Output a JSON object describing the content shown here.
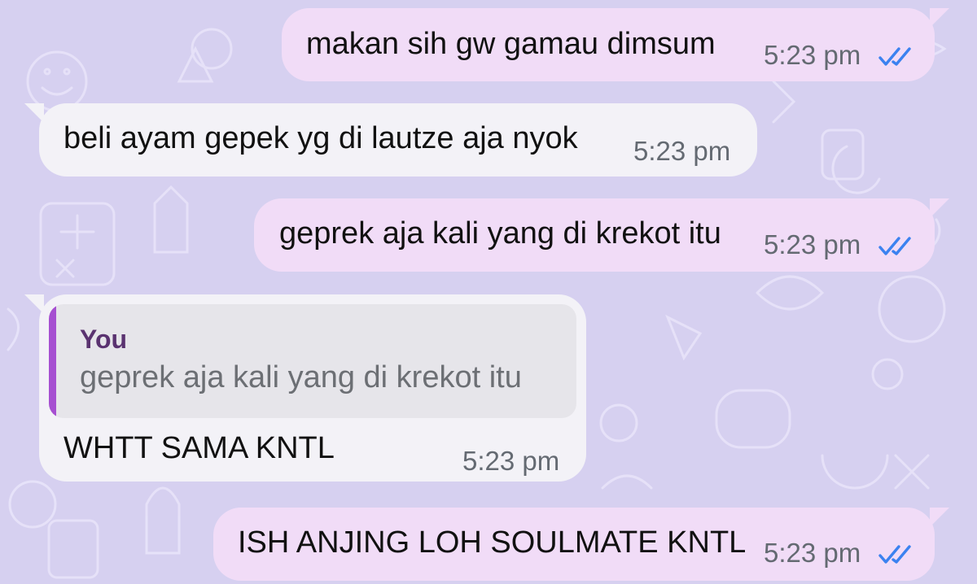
{
  "chat": {
    "colors": {
      "background": "#d6d0f0",
      "outgoing_bubble": "#f1dcf7",
      "incoming_bubble": "#f3f2f7",
      "read_ticks": "#3b82f0",
      "quote_accent": "#a64fd1"
    },
    "messages": [
      {
        "direction": "outgoing",
        "text": "makan sih gw gamau dimsum",
        "time": "5:23 pm",
        "status_icon": "double-check-read-icon"
      },
      {
        "direction": "incoming",
        "text": "beli ayam gepek yg di lautze aja nyok",
        "time": "5:23 pm"
      },
      {
        "direction": "outgoing",
        "text": "geprek aja kali yang di krekot itu",
        "time": "5:23 pm",
        "status_icon": "double-check-read-icon"
      },
      {
        "direction": "incoming",
        "quote": {
          "author": "You",
          "text": "geprek aja kali yang di krekot itu"
        },
        "text": "WHTT SAMA KNTL",
        "time": "5:23 pm"
      },
      {
        "direction": "outgoing",
        "text": "ISH ANJING LOH SOULMATE KNTL",
        "time": "5:23 pm",
        "status_icon": "double-check-read-icon"
      }
    ]
  }
}
